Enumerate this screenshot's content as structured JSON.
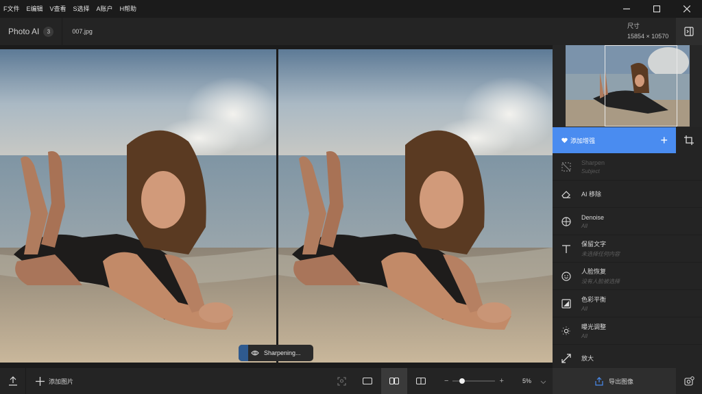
{
  "menu": [
    "F文件",
    "E编辑",
    "V查看",
    "S选择",
    "A账户",
    "H帮助"
  ],
  "toolbar": {
    "app_name": "Photo AI",
    "image_count": "3",
    "file_name": "007.jpg",
    "size_label": "尺寸",
    "size_value": "15854 × 10570"
  },
  "status": {
    "text": "Sharpening..."
  },
  "panel": {
    "add_enhancement": "添加增强",
    "enhancements": [
      {
        "title": "Sharpen",
        "subtitle": "Subject",
        "icon": "sharpen-icon",
        "disabled": true
      },
      {
        "title": "AI 移除",
        "subtitle": "",
        "icon": "eraser-icon",
        "disabled": false
      },
      {
        "title": "Denoise",
        "subtitle": "All",
        "icon": "denoise-icon",
        "disabled": false
      },
      {
        "title": "保留文字",
        "subtitle": "未选择任何内容",
        "icon": "text-icon",
        "disabled": false
      },
      {
        "title": "人脸恢复",
        "subtitle": "没有人脸被选择",
        "icon": "face-icon",
        "disabled": false
      },
      {
        "title": "色彩平衡",
        "subtitle": "All",
        "icon": "color-balance-icon",
        "disabled": false
      },
      {
        "title": "曝光调整",
        "subtitle": "All",
        "icon": "exposure-icon",
        "disabled": false
      },
      {
        "title": "放大",
        "subtitle": "",
        "icon": "upscale-icon",
        "disabled": false
      }
    ]
  },
  "bottom": {
    "add_image": "添加图片",
    "zoom_percent": "5%",
    "zoom_level": 0.22,
    "export_label": "导出图像"
  },
  "colors": {
    "accent": "#4a8cf0",
    "background": "#1b1b1b",
    "panel": "#242424"
  }
}
